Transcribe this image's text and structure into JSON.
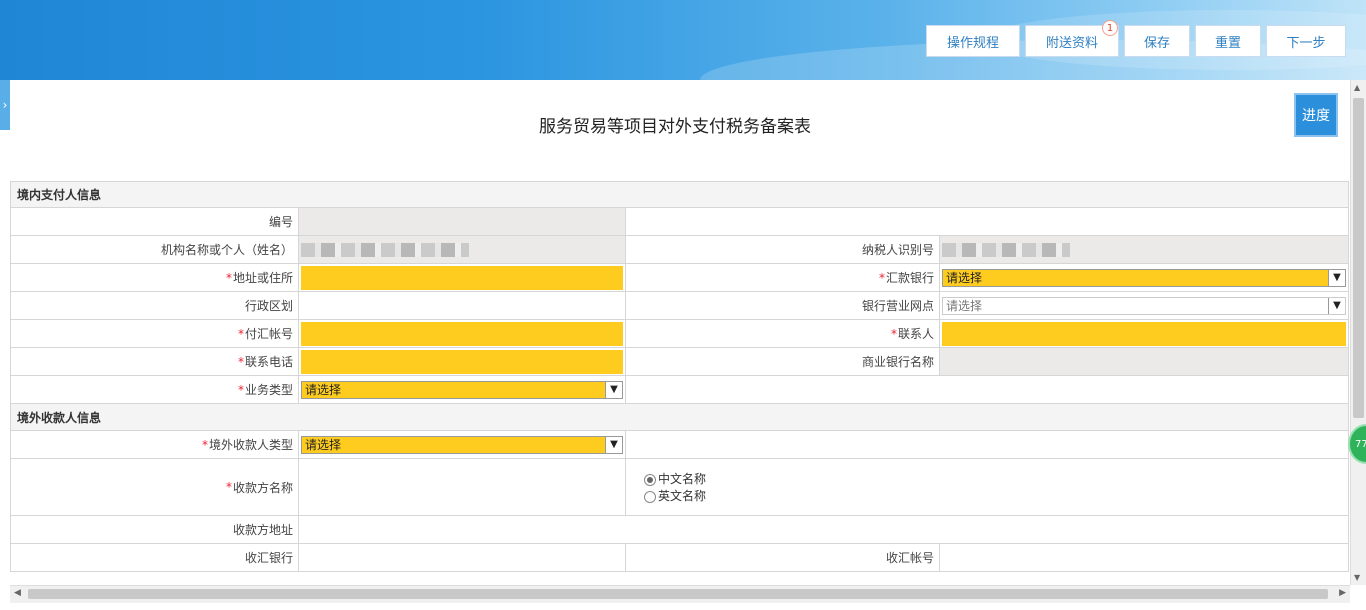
{
  "toolbar": {
    "buttons": [
      "操作规程",
      "附送资料",
      "保存",
      "重置",
      "下一步"
    ],
    "attach_badge": "1"
  },
  "side_tab_icon": "chevron-right",
  "page_title": "服务贸易等项目对外支付税务备案表",
  "progress_label": "进度",
  "section1": {
    "title": "境内支付人信息",
    "f_number": "编号",
    "f_org_name": "机构名称或个人（姓名）",
    "f_taxpayer_id": "纳税人识别号",
    "f_address": "地址或住所",
    "f_remit_bank": "汇款银行",
    "remit_bank_value": "请选择",
    "f_admin_region": "行政区划",
    "f_branch": "银行营业网点",
    "branch_value": "请选择",
    "f_pay_account": "付汇帐号",
    "f_contact": "联系人",
    "f_phone": "联系电话",
    "f_commercial_bank": "商业银行名称",
    "f_biz_type": "业务类型",
    "biz_type_value": "请选择"
  },
  "section2": {
    "title": "境外收款人信息",
    "f_payee_type": "境外收款人类型",
    "payee_type_value": "请选择",
    "f_payee_name": "收款方名称",
    "name_options": [
      "中文名称",
      "英文名称"
    ],
    "name_selected": "中文名称",
    "f_payee_address": "收款方地址",
    "f_recv_bank": "收汇银行",
    "f_recv_account": "收汇帐号"
  },
  "float_badge": "77",
  "colors": {
    "required_bg": "#fecc1f",
    "readonly_bg": "#ece9e9",
    "accent": "#2b8fdb"
  }
}
